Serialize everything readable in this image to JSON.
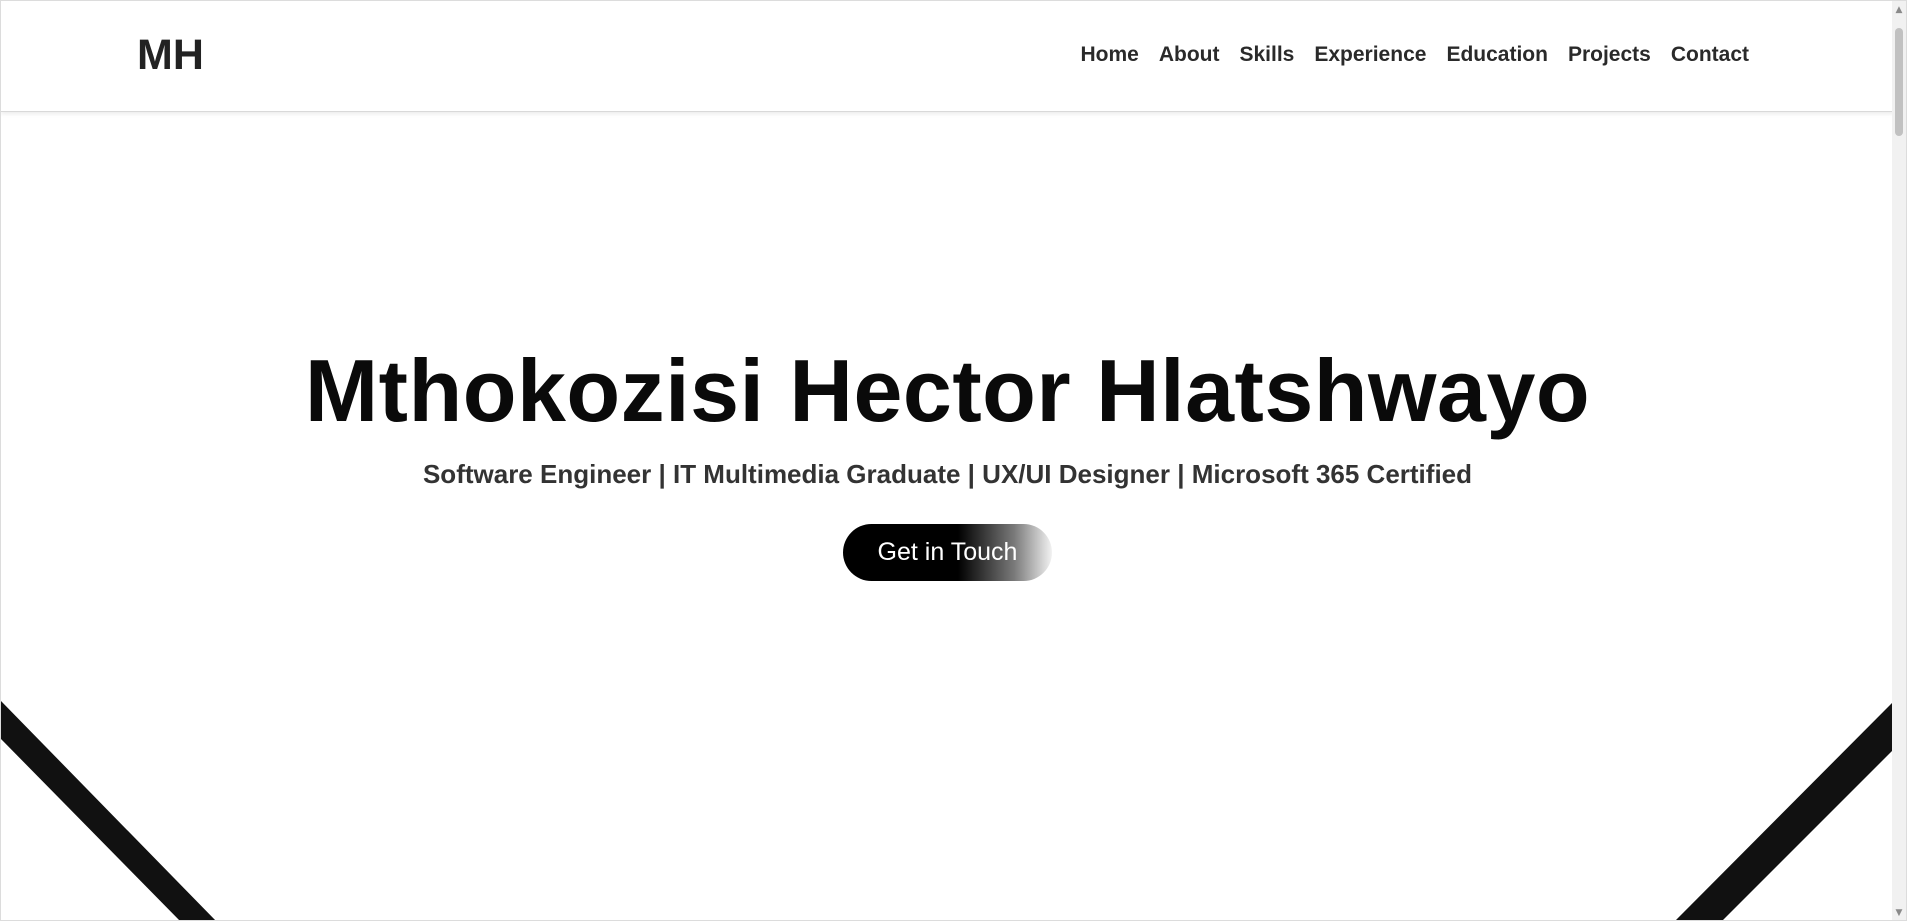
{
  "header": {
    "logo": "MH",
    "nav": [
      {
        "label": "Home"
      },
      {
        "label": "About"
      },
      {
        "label": "Skills"
      },
      {
        "label": "Experience"
      },
      {
        "label": "Education"
      },
      {
        "label": "Projects"
      },
      {
        "label": "Contact"
      }
    ]
  },
  "hero": {
    "title": "Mthokozisi Hector Hlatshwayo",
    "subtitle": "Software Engineer | IT Multimedia Graduate | UX/UI Designer | Microsoft 365 Certified",
    "cta_label": "Get in Touch"
  },
  "icons": {
    "scroll_up": "scroll-up-arrow-icon",
    "scroll_down": "scroll-down-arrow-icon"
  },
  "colors": {
    "text_dark": "#0a0a0a",
    "nav_text": "#2a2a2a",
    "stripe": "#111111",
    "cta_start": "#000000",
    "cta_end": "#f2f2f2"
  }
}
